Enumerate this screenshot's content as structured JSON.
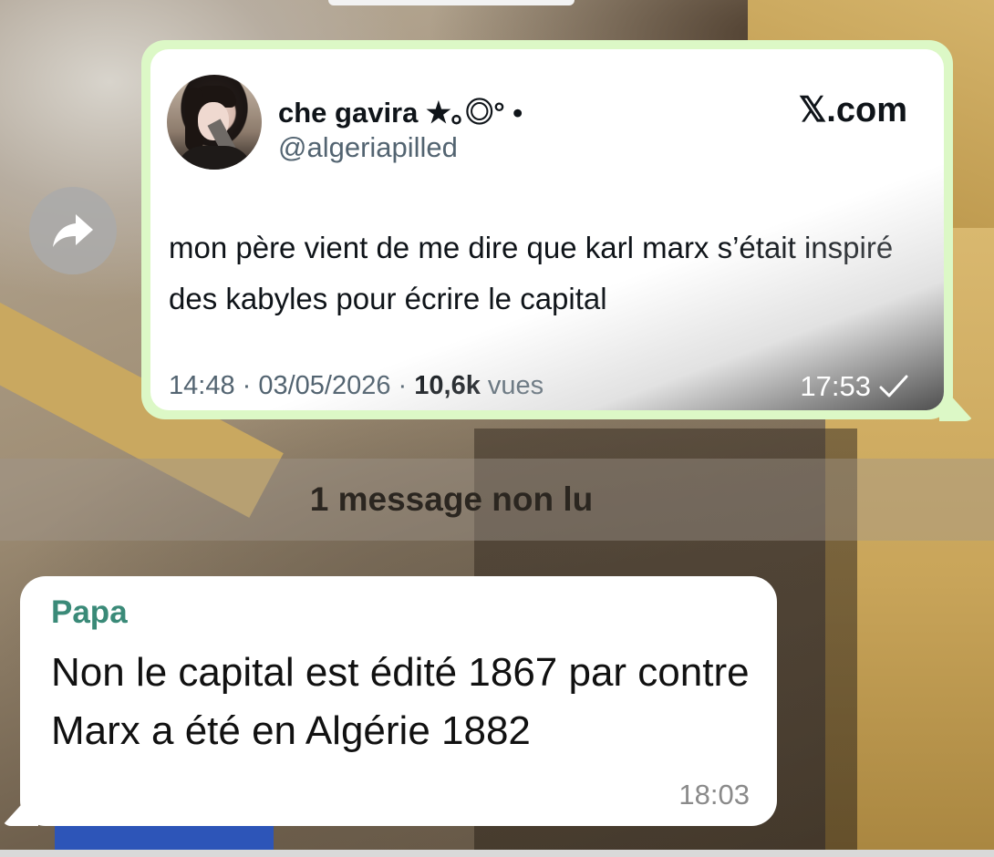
{
  "forward_button": {
    "icon": "share-arrow-icon"
  },
  "outgoing_message": {
    "tweet": {
      "author_name": "che gavira ★｡◎° •",
      "author_handle": "@algeriapilled",
      "source": "𝕏.com",
      "text": "mon père vient de me dire que karl marx s’était inspiré des kabyles pour écrire le capital",
      "posted": "14:48 · 03/05/2026 · ",
      "views_count": "10,6k",
      "views_label": " vues"
    },
    "time": "17:53",
    "status_icon": "sent-check-icon"
  },
  "unread_divider": {
    "label": "1 message non lu"
  },
  "incoming_message": {
    "sender": "Papa",
    "text": "Non le capital est édité 1867 par contre Marx a été en Algérie 1882",
    "time": "18:03"
  },
  "colors": {
    "outgoing_bubble": "#dcf8c6",
    "incoming_bubble": "#ffffff",
    "sender_name": "#3a8a78",
    "handle_gray": "#536471"
  }
}
